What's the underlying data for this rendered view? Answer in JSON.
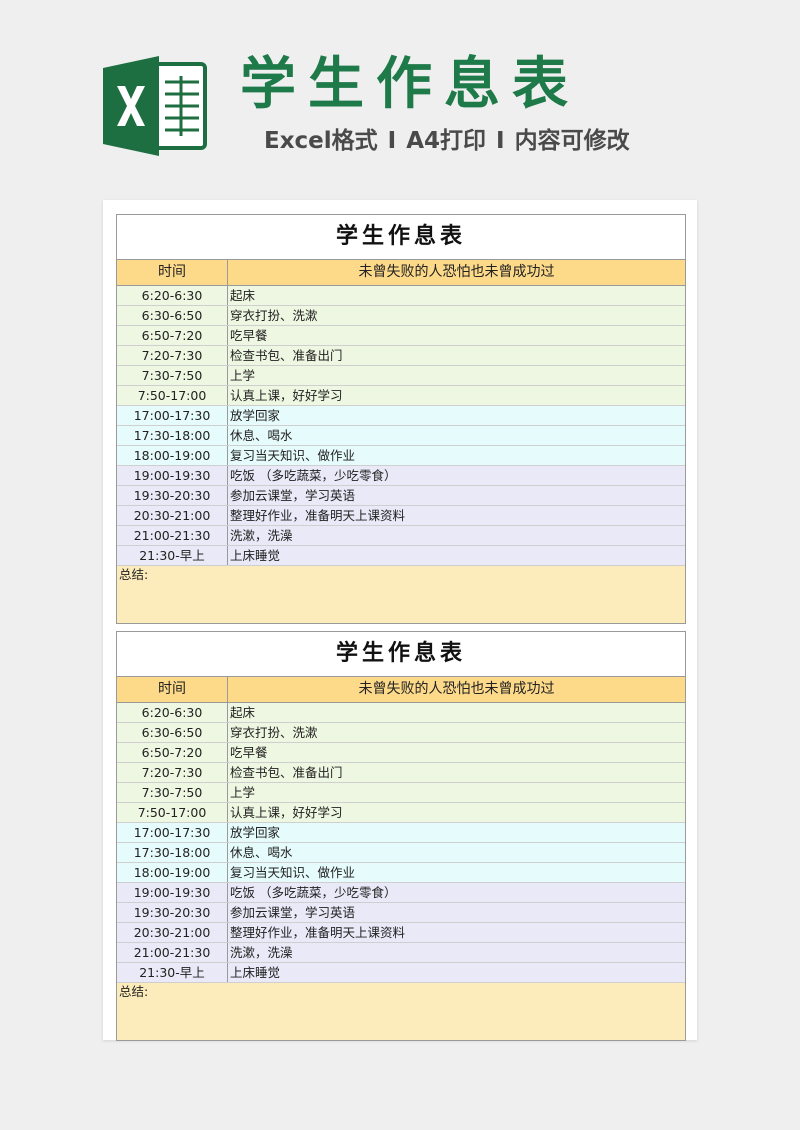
{
  "header": {
    "title": "学生作息表",
    "subtitle_parts": [
      "Excel格式",
      "A4打印",
      "内容可修改"
    ],
    "separator": "I"
  },
  "sheets": [
    {
      "title": "学生作息表",
      "col_time": "时间",
      "motto": "未曾失败的人恐怕也未曾成功过",
      "rows": [
        {
          "time": "6:20-6:30",
          "activity": "起床",
          "tone": "green"
        },
        {
          "time": "6:30-6:50",
          "activity": "穿衣打扮、洗漱",
          "tone": "green"
        },
        {
          "time": "6:50-7:20",
          "activity": "吃早餐",
          "tone": "green"
        },
        {
          "time": "7:20-7:30",
          "activity": "检查书包、准备出门",
          "tone": "green"
        },
        {
          "time": "7:30-7:50",
          "activity": "上学",
          "tone": "green"
        },
        {
          "time": "7:50-17:00",
          "activity": "认真上课，好好学习",
          "tone": "green"
        },
        {
          "time": "17:00-17:30",
          "activity": "放学回家",
          "tone": "cyan"
        },
        {
          "time": "17:30-18:00",
          "activity": "休息、喝水",
          "tone": "cyan"
        },
        {
          "time": "18:00-19:00",
          "activity": "复习当天知识、做作业",
          "tone": "cyan"
        },
        {
          "time": "19:00-19:30",
          "activity": "吃饭 （多吃蔬菜，少吃零食）",
          "tone": "purple"
        },
        {
          "time": "19:30-20:30",
          "activity": "参加云课堂，学习英语",
          "tone": "purple"
        },
        {
          "time": "20:30-21:00",
          "activity": "整理好作业，准备明天上课资料",
          "tone": "purple"
        },
        {
          "time": "21:00-21:30",
          "activity": "洗漱，洗澡",
          "tone": "purple"
        },
        {
          "time": "21:30-早上",
          "activity": "上床睡觉",
          "tone": "purple"
        }
      ],
      "summary_label": "总结:"
    },
    {
      "title": "学生作息表",
      "col_time": "时间",
      "motto": "未曾失败的人恐怕也未曾成功过",
      "rows": [
        {
          "time": "6:20-6:30",
          "activity": "起床",
          "tone": "green"
        },
        {
          "time": "6:30-6:50",
          "activity": "穿衣打扮、洗漱",
          "tone": "green"
        },
        {
          "time": "6:50-7:20",
          "activity": "吃早餐",
          "tone": "green"
        },
        {
          "time": "7:20-7:30",
          "activity": "检查书包、准备出门",
          "tone": "green"
        },
        {
          "time": "7:30-7:50",
          "activity": "上学",
          "tone": "green"
        },
        {
          "time": "7:50-17:00",
          "activity": "认真上课，好好学习",
          "tone": "green"
        },
        {
          "time": "17:00-17:30",
          "activity": "放学回家",
          "tone": "cyan"
        },
        {
          "time": "17:30-18:00",
          "activity": "休息、喝水",
          "tone": "cyan"
        },
        {
          "time": "18:00-19:00",
          "activity": "复习当天知识、做作业",
          "tone": "cyan"
        },
        {
          "time": "19:00-19:30",
          "activity": "吃饭 （多吃蔬菜，少吃零食）",
          "tone": "purple"
        },
        {
          "time": "19:30-20:30",
          "activity": "参加云课堂，学习英语",
          "tone": "purple"
        },
        {
          "time": "20:30-21:00",
          "activity": "整理好作业，准备明天上课资料",
          "tone": "purple"
        },
        {
          "time": "21:00-21:30",
          "activity": "洗漱，洗澡",
          "tone": "purple"
        },
        {
          "time": "21:30-早上",
          "activity": "上床睡觉",
          "tone": "purple"
        }
      ],
      "summary_label": "总结:"
    }
  ],
  "colors": {
    "brand_green": "#1f7a4a",
    "header_row": "#fdd98a",
    "block_green": "#eef7e1",
    "block_cyan": "#e6fbfb",
    "block_purple": "#e9e9f8",
    "summary": "#fdecbb"
  },
  "icons": {
    "logo": "excel-logo-icon"
  }
}
